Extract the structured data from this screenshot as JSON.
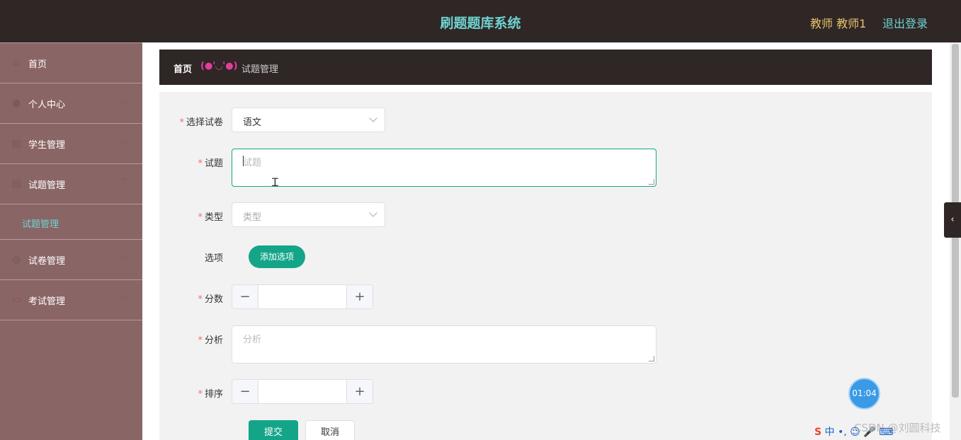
{
  "header": {
    "app_title": "刷题题库系统",
    "user_info": "教师 教师1",
    "logout_label": "退出登录"
  },
  "sidebar": {
    "items": [
      {
        "label": "首页",
        "icon": "home-icon"
      },
      {
        "label": "个人中心",
        "icon": "user-icon"
      },
      {
        "label": "学生管理",
        "icon": "building-icon"
      },
      {
        "label": "试题管理",
        "icon": "building-icon",
        "expanded": true
      },
      {
        "label": "试卷管理",
        "icon": "globe-icon"
      },
      {
        "label": "考试管理",
        "icon": "chat-icon"
      }
    ],
    "submenu_label": "试题管理"
  },
  "breadcrumb": {
    "home": "首页",
    "separator": "(●'◡'●)",
    "current": "试题管理"
  },
  "form": {
    "paper_label": "选择试卷",
    "paper_value": "语文",
    "question_label": "试题",
    "question_placeholder": "试题",
    "type_label": "类型",
    "type_placeholder": "类型",
    "options_label": "选项",
    "add_option_label": "添加选项",
    "score_label": "分数",
    "analysis_label": "分析",
    "analysis_placeholder": "分析",
    "order_label": "排序",
    "submit_label": "提交",
    "cancel_label": "取消"
  },
  "overlay": {
    "timer": "01:04",
    "watermark": "CSDN @刘圆科技",
    "ime_text": "中 •, ☺ 🎤 ⌨"
  },
  "colors": {
    "topbar": "#2f2626",
    "sidebar": "#8a6565",
    "accent": "#14a589",
    "title": "#6fd3cf"
  }
}
